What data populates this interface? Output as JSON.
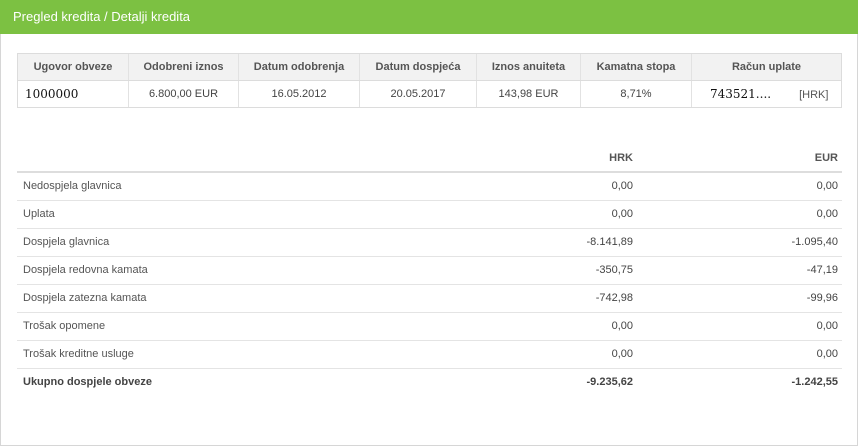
{
  "header": {
    "title": "Pregled kredita / Detalji kredita"
  },
  "summary": {
    "columns": [
      "Ugovor obveze",
      "Odobreni iznos",
      "Datum odobrenja",
      "Datum dospjeća",
      "Iznos anuiteta",
      "Kamatna stopa",
      "Račun uplate"
    ],
    "row": {
      "contract": "1000000",
      "approved_amount": "6.800,00 EUR",
      "approval_date": "16.05.2012",
      "due_date": "20.05.2017",
      "annuity": "143,98 EUR",
      "interest_rate": "8,71%",
      "payment_account": "743521....",
      "payment_currency": "[HRK]"
    }
  },
  "details": {
    "col_hrk": "HRK",
    "col_eur": "EUR",
    "rows": [
      {
        "label": "Nedospjela glavnica",
        "hrk": "0,00",
        "eur": "0,00"
      },
      {
        "label": "Uplata",
        "hrk": "0,00",
        "eur": "0,00"
      },
      {
        "label": "Dospjela glavnica",
        "hrk": "-8.141,89",
        "eur": "-1.095,40"
      },
      {
        "label": "Dospjela redovna kamata",
        "hrk": "-350,75",
        "eur": "-47,19"
      },
      {
        "label": "Dospjela zatezna kamata",
        "hrk": "-742,98",
        "eur": "-99,96"
      },
      {
        "label": "Trošak opomene",
        "hrk": "0,00",
        "eur": "0,00"
      },
      {
        "label": "Trošak kreditne usluge",
        "hrk": "0,00",
        "eur": "0,00"
      },
      {
        "label": "Ukupno dospjele obveze",
        "hrk": "-9.235,62",
        "eur": "-1.242,55"
      }
    ]
  },
  "colors": {
    "header_bg": "#7cc142",
    "header_text": "#ffffff",
    "table_header_bg": "#f2f2f2"
  }
}
